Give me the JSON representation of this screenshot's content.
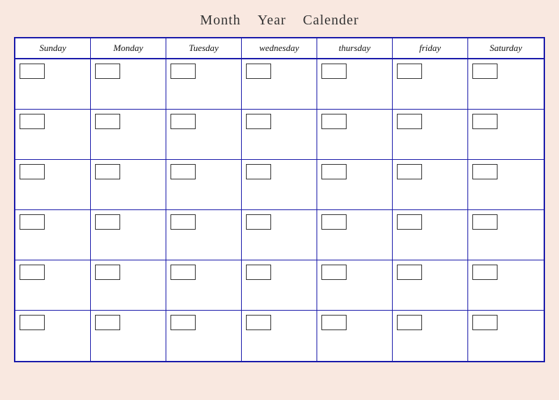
{
  "header": {
    "month_label": "Month",
    "year_label": "Year",
    "calender_label": "Calender"
  },
  "days": [
    "Sunday",
    "Monday",
    "Tuesday",
    "wednesday",
    "thursday",
    "friday",
    "Saturday"
  ],
  "rows": 6,
  "cols": 7
}
